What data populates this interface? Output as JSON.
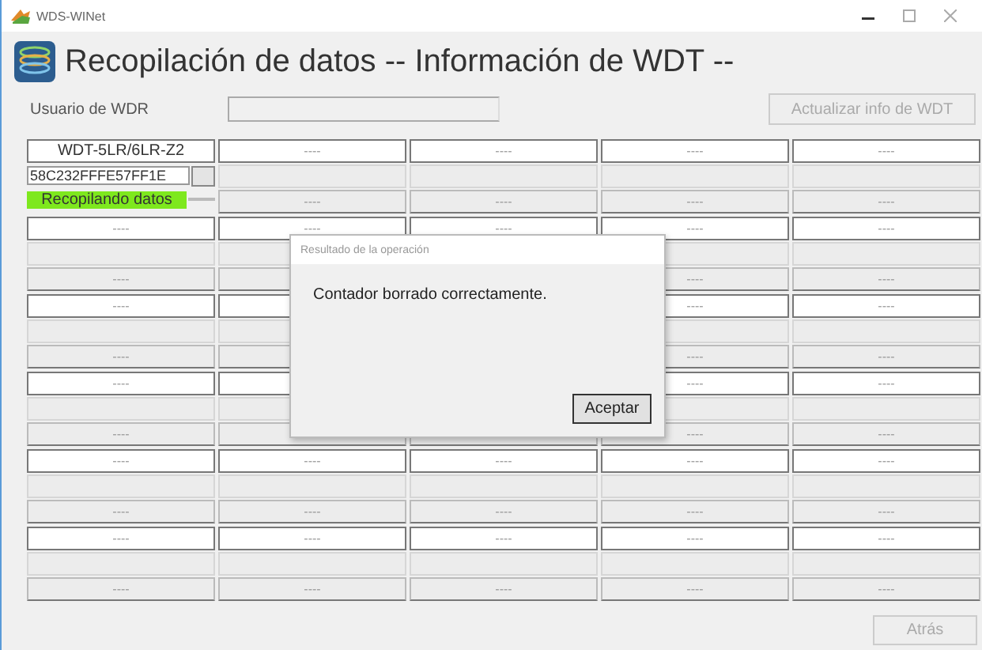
{
  "window": {
    "title": "WDS-WINet"
  },
  "header": {
    "title": "Recopilación de datos -- Información de WDT --"
  },
  "user": {
    "label": "Usuario de WDR"
  },
  "update_button": {
    "label": "Actualizar info de WDT",
    "disabled": true
  },
  "grid": [
    [
      {
        "kind": "device",
        "name": "WDT-5LR/6LR-Z2",
        "id": "58C232FFFE57FF1E",
        "status": "Recopilando datos",
        "color": "#7ee81e"
      },
      {
        "kind": "empty",
        "top": "----",
        "bottom": "----"
      },
      {
        "kind": "empty",
        "top": "----",
        "bottom": "----"
      },
      {
        "kind": "empty",
        "top": "----",
        "bottom": "----"
      },
      {
        "kind": "empty",
        "top": "----",
        "bottom": "----"
      }
    ],
    [
      {
        "kind": "empty",
        "top": "----",
        "bottom": "----"
      },
      {
        "kind": "empty",
        "top": "----"
      },
      {
        "kind": "partial",
        "top": "----"
      },
      {
        "kind": "empty",
        "top": "----",
        "bottom": "----"
      },
      {
        "kind": "empty",
        "top": "----",
        "bottom": "----"
      }
    ],
    [
      {
        "kind": "empty",
        "top": "----",
        "bottom": "----"
      },
      {
        "kind": "empty"
      },
      {
        "kind": "covered"
      },
      {
        "kind": "empty",
        "top": "----",
        "bottom": "----"
      },
      {
        "kind": "empty",
        "top": "----",
        "bottom": "----"
      }
    ],
    [
      {
        "kind": "empty",
        "top": "----",
        "bottom": "----"
      },
      {
        "kind": "empty"
      },
      {
        "kind": "covered"
      },
      {
        "kind": "empty",
        "top": "----",
        "bottom": "----"
      },
      {
        "kind": "empty",
        "top": "----",
        "bottom": "----"
      }
    ],
    [
      {
        "kind": "empty",
        "top": "----",
        "bottom": "----"
      },
      {
        "kind": "empty",
        "top": "----",
        "bottom": "----"
      },
      {
        "kind": "empty",
        "top": "----",
        "bottom": "----"
      },
      {
        "kind": "empty",
        "top": "----",
        "bottom": "----"
      },
      {
        "kind": "empty",
        "top": "----",
        "bottom": "----"
      }
    ],
    [
      {
        "kind": "empty",
        "top": "----",
        "bottom": "----"
      },
      {
        "kind": "empty",
        "top": "----",
        "bottom": "----"
      },
      {
        "kind": "empty",
        "top": "----",
        "bottom": "----"
      },
      {
        "kind": "empty",
        "top": "----",
        "bottom": "----"
      },
      {
        "kind": "empty",
        "top": "----",
        "bottom": "----"
      }
    ]
  ],
  "back_button": {
    "label": "Atrás",
    "disabled": true
  },
  "dialog": {
    "title": "Resultado de la operación",
    "message": "Contador borrado correctamente.",
    "button": "Aceptar"
  }
}
